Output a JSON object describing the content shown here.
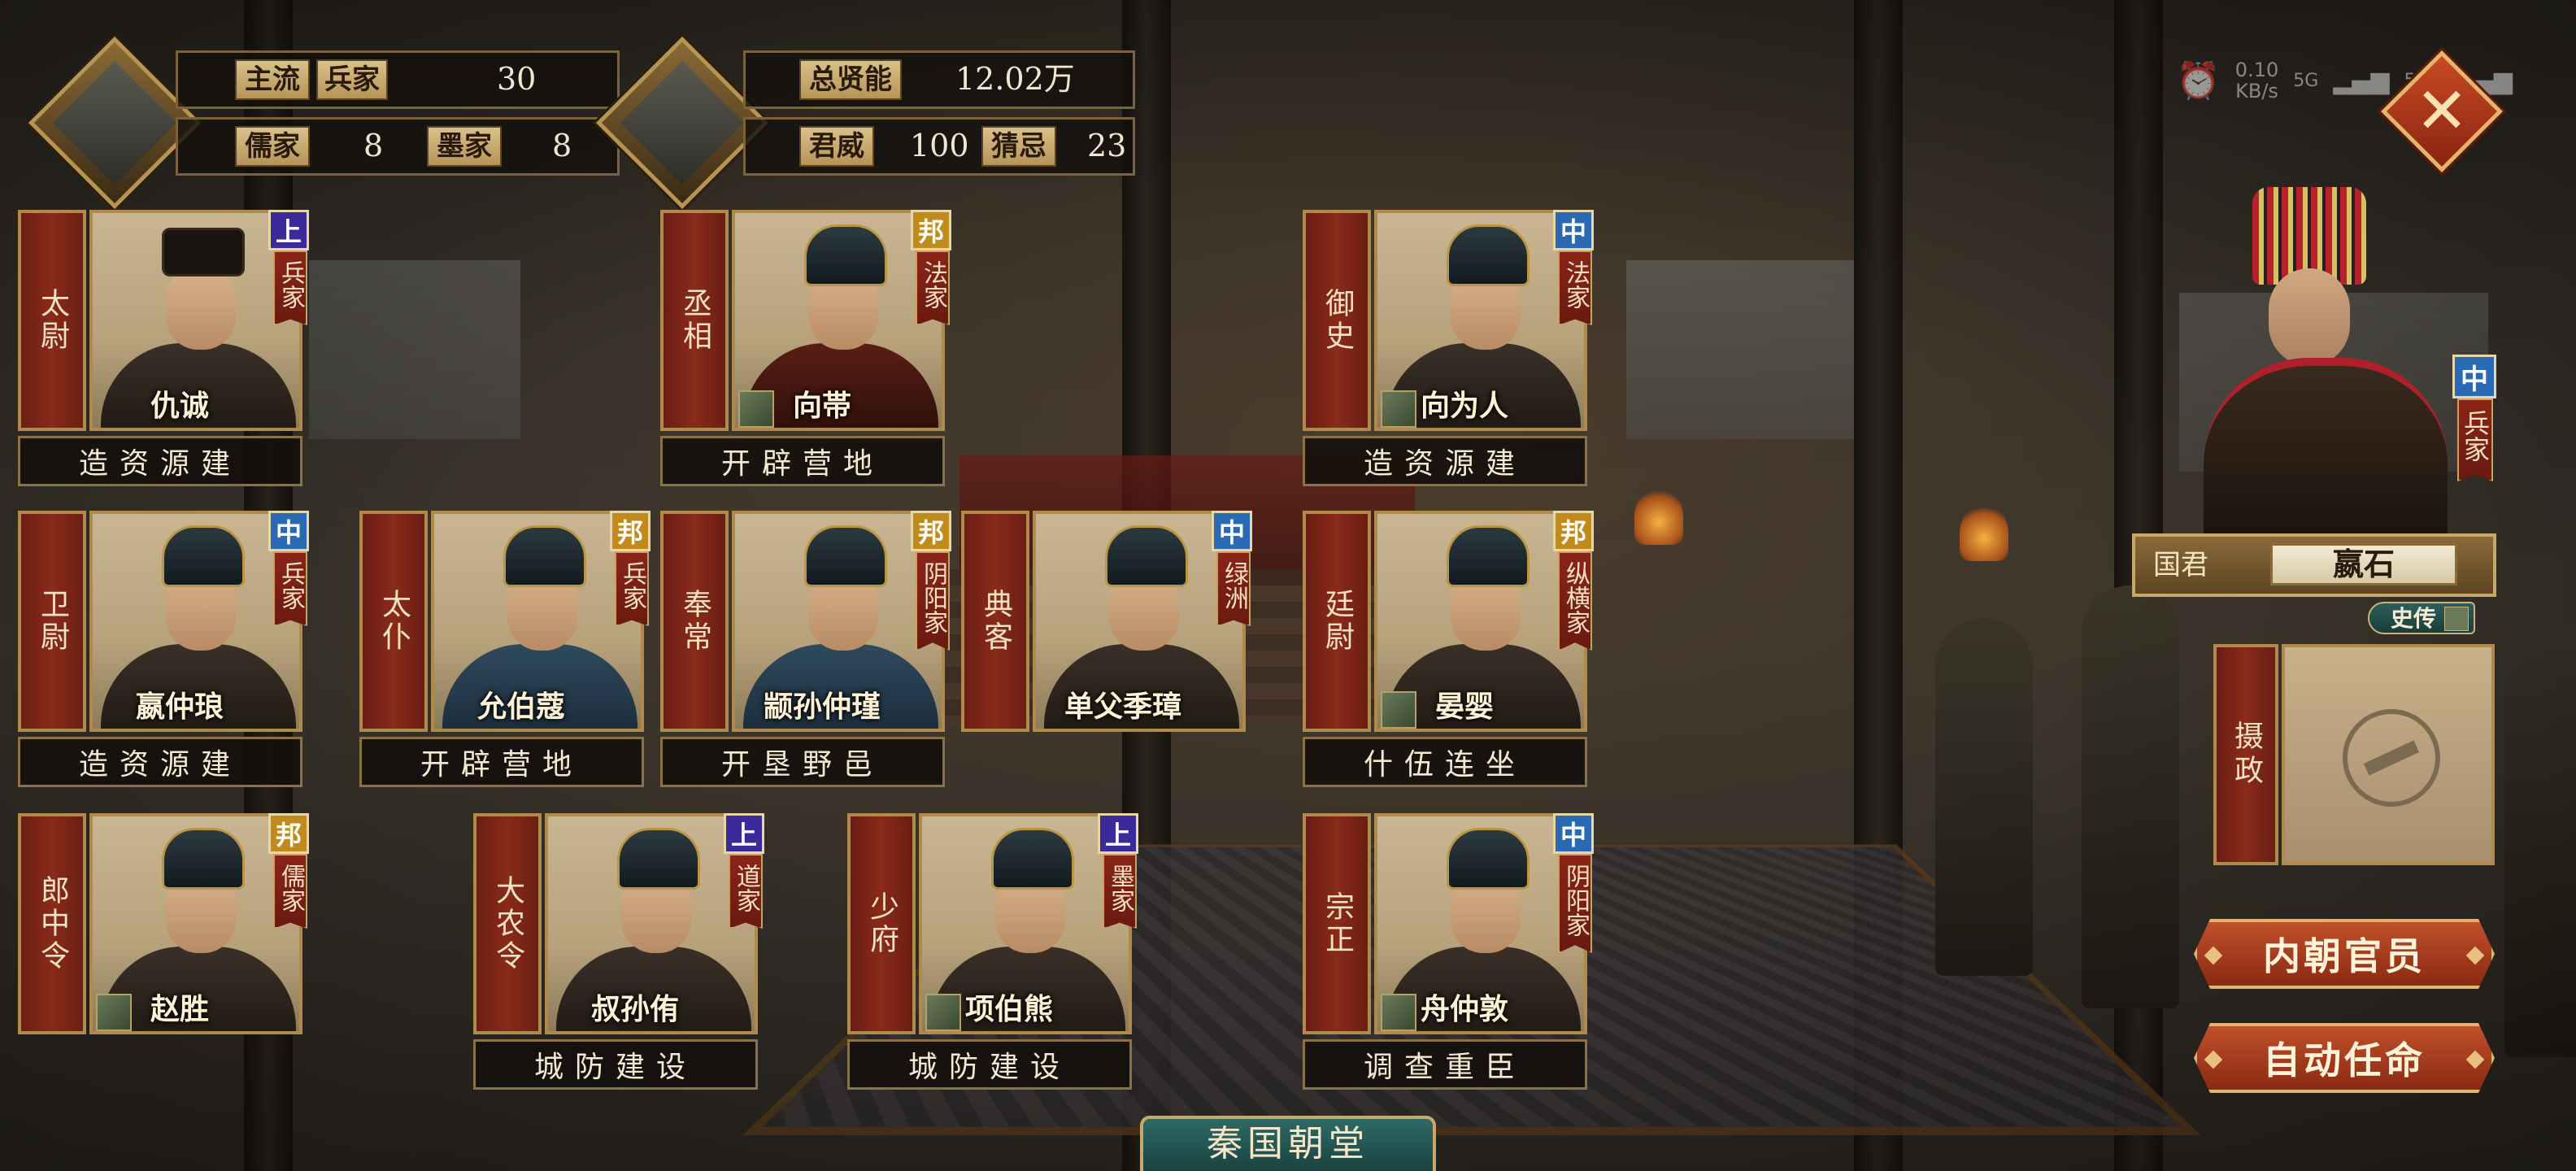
{
  "stats_left": {
    "mainstream_label": "主流",
    "mainstream_school": "兵家",
    "mainstream_value": "30",
    "ru_label": "儒家",
    "ru_value": "8",
    "mo_label": "墨家",
    "mo_value": "8"
  },
  "stats_right": {
    "total_talent_label": "总贤能",
    "total_talent_value": "12.02万",
    "authority_label": "君威",
    "authority_value": "100",
    "suspicion_label": "猜忌",
    "suspicion_value": "23"
  },
  "status_bar": {
    "speed_value": "0.10",
    "speed_unit": "KB/s",
    "net1": "5G",
    "net2": "5GA"
  },
  "officials": [
    {
      "office": "太尉",
      "name": "仇诚",
      "grade": "上",
      "school": "兵家",
      "task": "造资源建"
    },
    {
      "office": "丞相",
      "name": "向帯",
      "grade": "邦",
      "school": "法家",
      "task": "开辟营地"
    },
    {
      "office": "御史",
      "name": "向为人",
      "grade": "中",
      "school": "法家",
      "task": "造资源建"
    },
    {
      "office": "卫尉",
      "name": "嬴仲琅",
      "grade": "中",
      "school": "兵家",
      "task": "造资源建"
    },
    {
      "office": "太仆",
      "name": "允伯蔻",
      "grade": "邦",
      "school": "兵家",
      "task": "开辟营地"
    },
    {
      "office": "奉常",
      "name": "颛孙仲瑾",
      "grade": "邦",
      "school": "阴阳家",
      "task": "开垦野邑"
    },
    {
      "office": "典客",
      "name": "单父季璋",
      "grade": "中",
      "school": "绿洲",
      "task": ""
    },
    {
      "office": "廷尉",
      "name": "晏婴",
      "grade": "邦",
      "school": "纵横家",
      "task": "什伍连坐"
    },
    {
      "office": "郎中令",
      "name": "赵胜",
      "grade": "邦",
      "school": "儒家",
      "task": ""
    },
    {
      "office": "大农令",
      "name": "叔孙侑",
      "grade": "上",
      "school": "道家",
      "task": "城防建设"
    },
    {
      "office": "少府",
      "name": "项伯熊",
      "grade": "上",
      "school": "墨家",
      "task": "城防建设"
    },
    {
      "office": "宗正",
      "name": "舟仲敦",
      "grade": "中",
      "school": "阴阳家",
      "task": "调查重臣"
    }
  ],
  "ruler": {
    "grade": "中",
    "school": "兵家",
    "title_label": "国君",
    "name": "嬴石",
    "history_button": "史传",
    "regent_label": "摄政"
  },
  "buttons": {
    "inner_court": "内朝官员",
    "auto_appoint": "自动任命",
    "close": "✕"
  },
  "court_tab": "秦国朝堂"
}
